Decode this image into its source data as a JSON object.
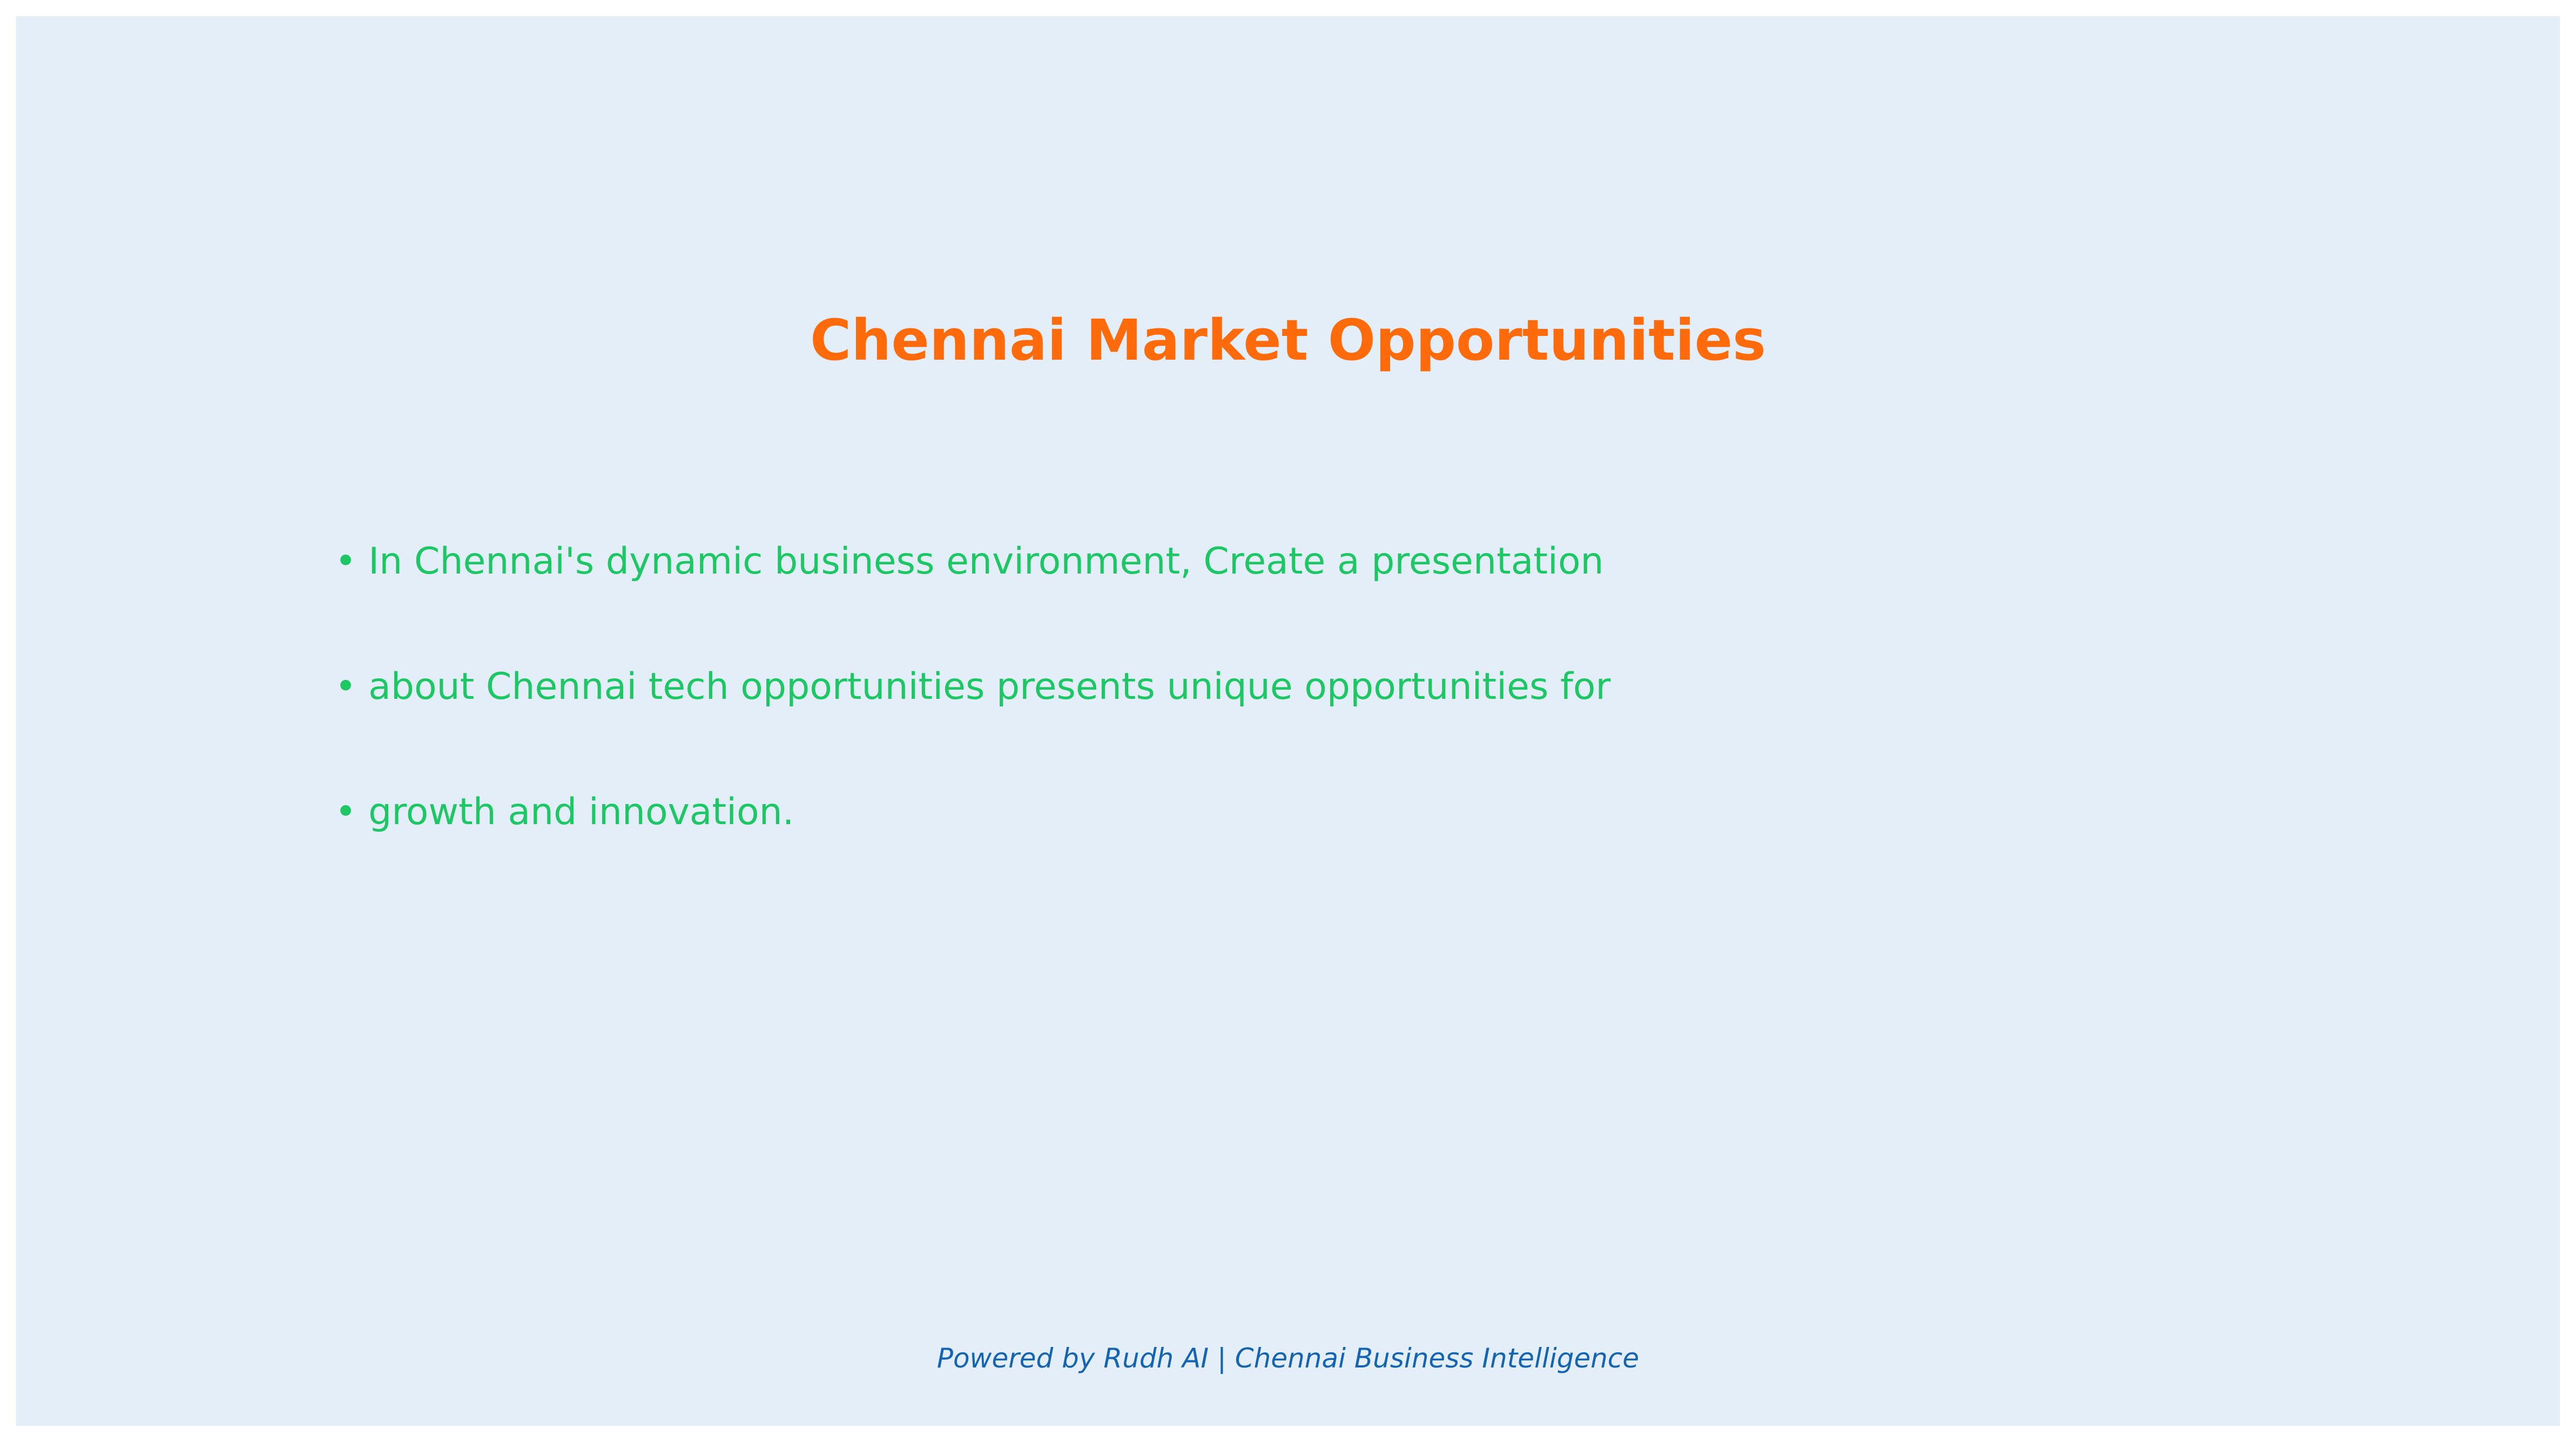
{
  "slide": {
    "title": "Chennai Market Opportunities",
    "bullet_glyph": "•",
    "bullets": [
      "In Chennai's dynamic business environment, Create a presentation",
      "about Chennai tech opportunities presents unique opportunities for",
      "growth and innovation."
    ],
    "footer": "Powered by Rudh AI | Chennai Business Intelligence"
  },
  "colors": {
    "background": "#e4eef8",
    "title": "#ff6a0a",
    "bullets": "#1cc764",
    "footer": "#1464b4"
  }
}
